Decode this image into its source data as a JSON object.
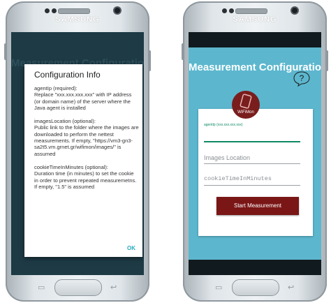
{
  "left_phone": {
    "brand": "SAMSUNG",
    "background_title": "Measurement Configuration",
    "dialog": {
      "title": "Configuration Info",
      "agent_ip_text": "agentIp (required):\nReplace \"xxx.xxx.xxx.xxx\" with IP address (or domain name) of the server where the Java agent is installed",
      "images_location_text": "imagesLocation (optional):\n Public link to the folder where the images are downloaded to perform the nettest measurements. If empty, \"https://vm3-gn3-sa2t5.vm.grnet.gr/wifimon/images/\" is assumed",
      "cookie_text": "cookieTimeInMinutes (optional):\nDuration time (in minutes) to set the cookie in order to prevent repeated measuremetns. If empty, \"1.5\" is assumed",
      "ok_label": "OK"
    }
  },
  "right_phone": {
    "brand": "SAMSUNG",
    "title": "Measurement Configuration",
    "logo_text": "WiFiMon",
    "agent_ip_label": "agentIp (xxx.xxx.xxx.xxx)",
    "images_location_placeholder": "Images Location",
    "cookie_placeholder": "cookieTimeInMinutes",
    "start_button": "Start Measurement"
  },
  "colors": {
    "accent_blue": "#5cb7ce",
    "button_red": "#7a1616",
    "ok_blue": "#26a9c0",
    "field_green": "#0e8a64"
  }
}
